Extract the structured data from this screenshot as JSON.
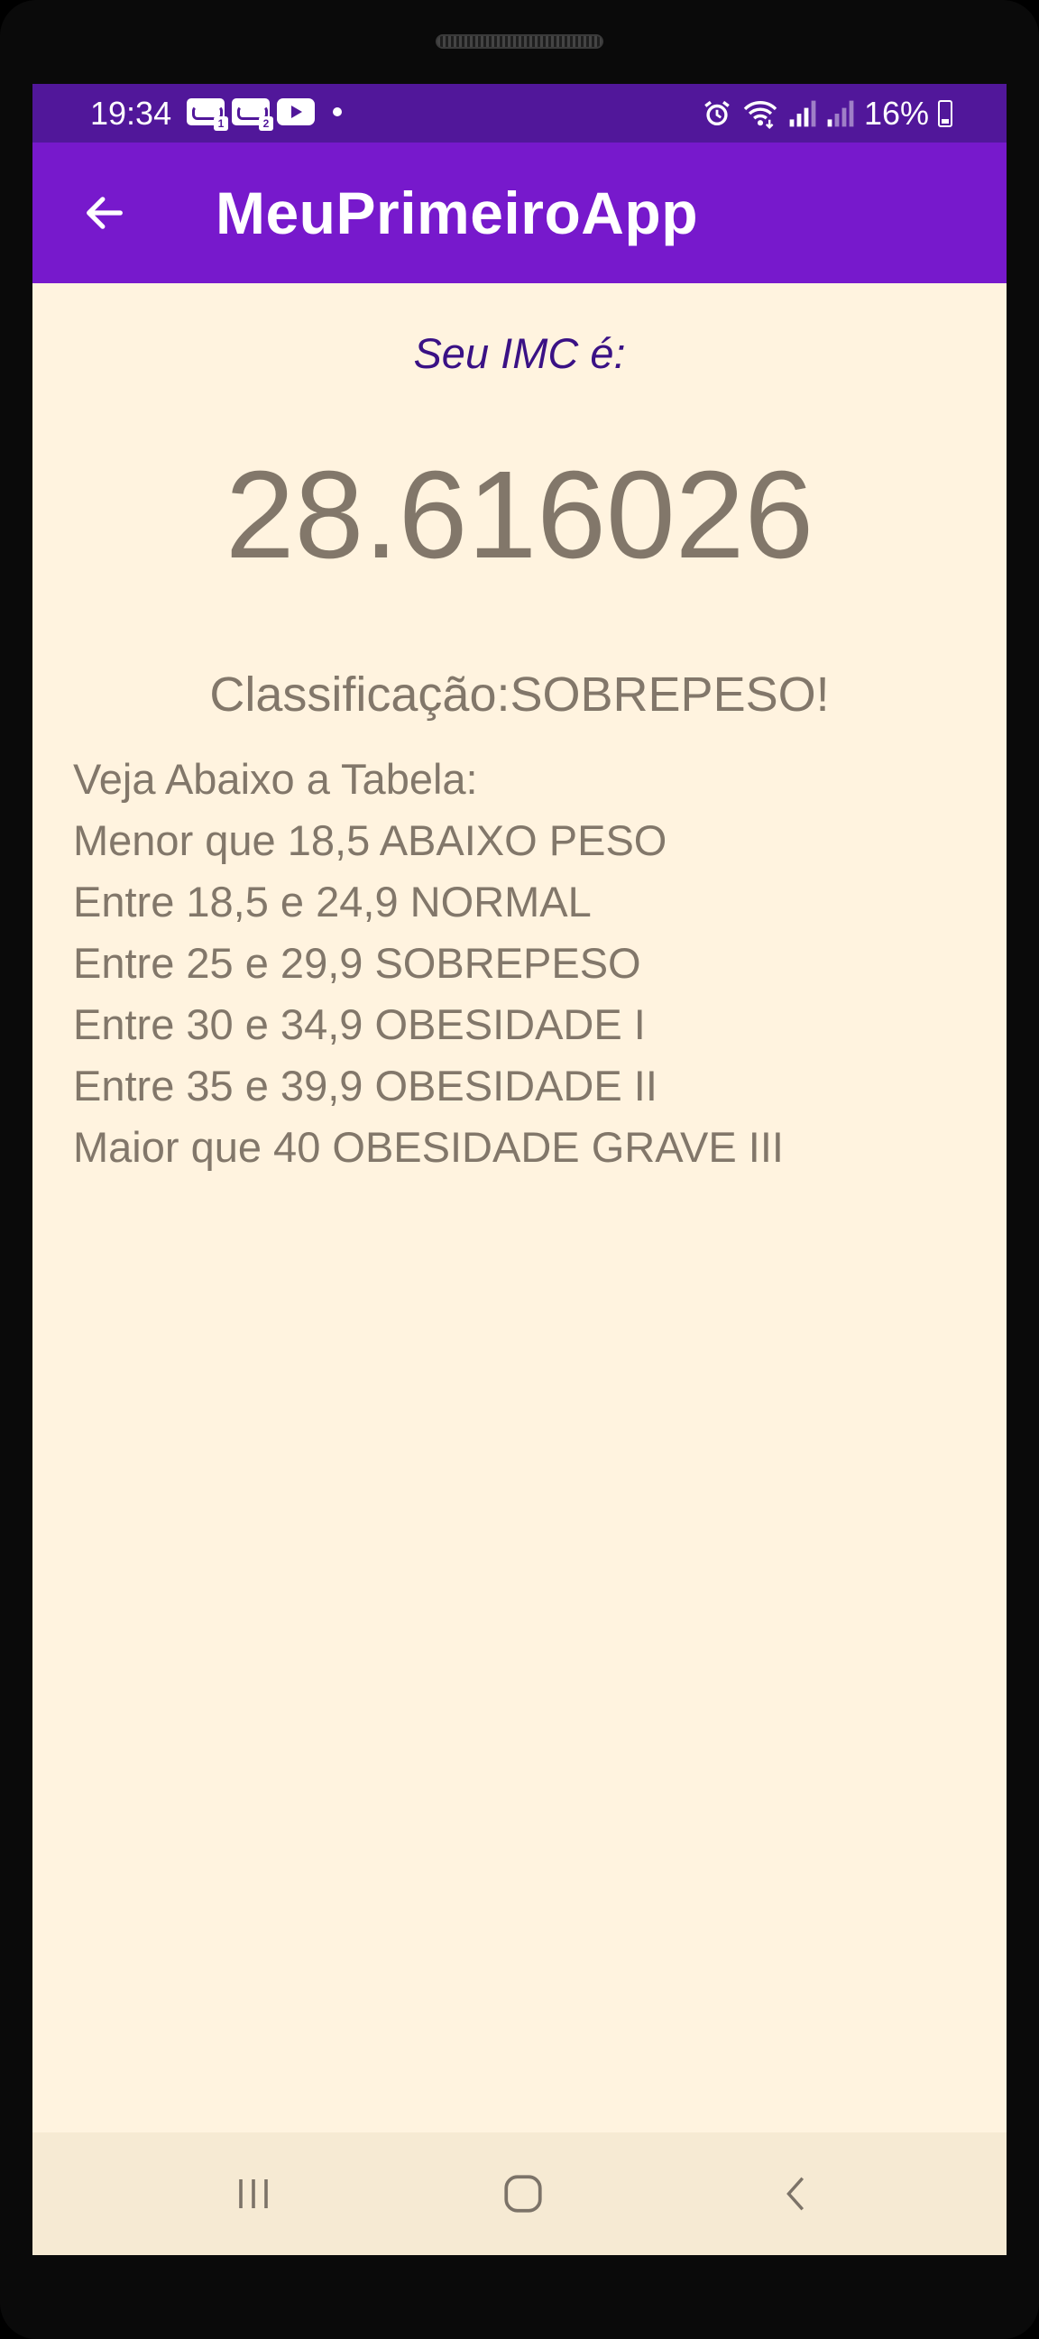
{
  "status_bar": {
    "time": "19:34",
    "battery": "16%",
    "notification_icons": [
      "voicemail-1-icon",
      "voicemail-2-icon",
      "youtube-icon",
      "dot-icon"
    ],
    "system_icons": [
      "alarm-icon",
      "wifi-icon",
      "signal-1-icon",
      "signal-2-icon",
      "battery-charging-icon"
    ]
  },
  "app_bar": {
    "title": "MeuPrimeiroApp",
    "back_icon": "arrow-back-icon"
  },
  "result": {
    "label": "Seu IMC é:",
    "value": "28.616026",
    "classification": "Classificação:SOBREPESO!"
  },
  "table": {
    "header": "Veja Abaixo a Tabela:",
    "rows": [
      "Menor que 18,5 ABAIXO PESO",
      "Entre 18,5 e 24,9 NORMAL",
      "Entre 25 e 29,9 SOBREPESO",
      "Entre 30 e 34,9 OBESIDADE I",
      "Entre 35 e 39,9 OBESIDADE II",
      "Maior que 40 OBESIDADE GRAVE III"
    ]
  },
  "nav_bar": {
    "buttons": [
      "recents-icon",
      "home-icon",
      "back-icon"
    ]
  },
  "colors": {
    "status_bar": "#51179a",
    "app_bar": "#7719cc",
    "background": "#fff3df",
    "label_text": "#3a1185",
    "body_text": "#82776a",
    "nav_bar": "#f6ead3"
  }
}
